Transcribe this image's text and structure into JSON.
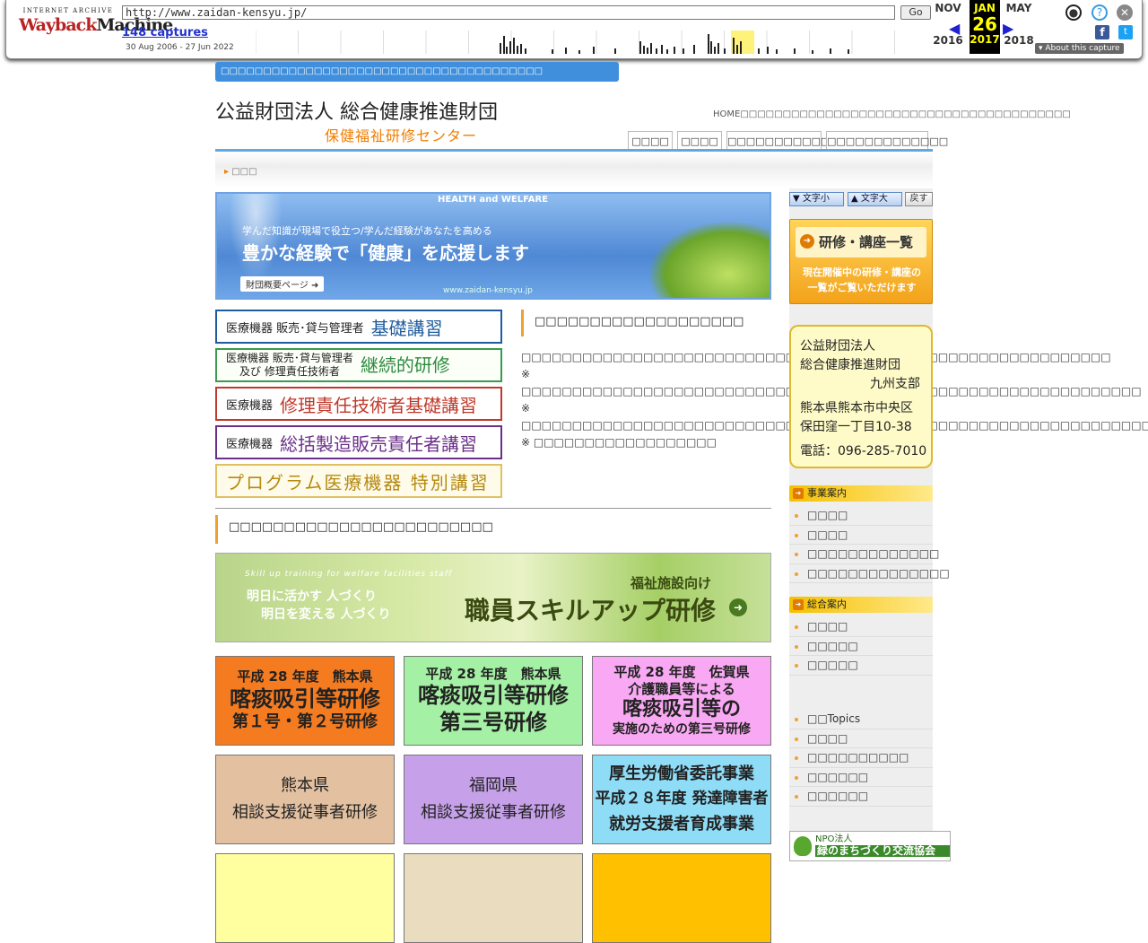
{
  "wayback": {
    "logo_top": "INTERNET ARCHIVE",
    "logo_a": "Wayback",
    "logo_b": "Machine",
    "url": "http://www.zaidan-kensyu.jp/",
    "go": "Go",
    "captures": "148 captures",
    "range": "30 Aug 2006 - 27 Jun 2022",
    "prev_month": "NOV",
    "prev_year": "2016",
    "cur_month": "JAN",
    "cur_day": "26",
    "cur_year": "2017",
    "next_month": "MAY",
    "next_year": "2018",
    "about": "▾ About this capture"
  },
  "header": {
    "topbar": "□□□□□□□□□□□□□□□□□□□□□□□□□□□□□□□□□□□□□□",
    "org_name": "公益財団法人 総合健康推進財団",
    "org_sub": "保健福祉研修センター",
    "top_links": "HOME□□□□□□□□□□□□□□□□□□□□□□□□□□□□□□□□□□□□□□□",
    "nav": [
      "□□□□",
      "□□□□",
      "□□□□□□□□□□□□",
      "□□□□□□□□□□□□□"
    ]
  },
  "breadcrumb": "□□□",
  "hero": {
    "tag": "HEALTH and WELFARE",
    "line1": "学んだ知識が現場で役立つ/学んだ経験があなたを高める",
    "line2": "豊かな経験で「健康」を応援します",
    "button": "財団概要ページ ➜",
    "url": "www.zaidan-kensyu.jp"
  },
  "courses": [
    {
      "small": "医療機器 販売･貸与管理者",
      "big": "基礎講習"
    },
    {
      "small": "医療機器 販売･貸与管理者\n及び 修理責任技術者",
      "big": "継続的研修"
    },
    {
      "small": "医療機器",
      "big": "修理責任技術者基礎講習"
    },
    {
      "small": "医療機器",
      "big": "総括製造販売責任者講習"
    },
    {
      "small": "",
      "big": "プログラム医療機器 特別講習"
    }
  ],
  "notice": {
    "heading": "□□□□□□□□□□□□□□□□□□□",
    "p1": "□□□□□□□□□□□□□□□□□□□□□□□□□□□□□□□□□□□□□□□□□□□□□□□□□□□□□□□□□□",
    "p2": "※ □□□□□□□□□□□□□□□□□□□□□□□□□□□□□□□□□□□□□□□□□□□□□□□□□□□□□□□□□□□□□",
    "p3": "※ □□□□□□□□□□□□□□□□□□□□□□□□□□□□□□□□□□□□□□□□□□□□□□□□□□□□□□□□□□□□□□□□□",
    "p4": "※ □□□□□□□□□□□□□□□□□□"
  },
  "section2_heading": "□□□□□□□□□□□□□□□□□□□□□□□□",
  "skill": {
    "en": "Skill up training for welfare facilities staff",
    "a1": "明日に活かす 人づくり",
    "a2": "明日を変える 人づくり",
    "b": "福祉施設向け",
    "c": "職員スキルアップ研修",
    "go": "➜"
  },
  "boxes": [
    {
      "l1": "平成 28 年度　熊本県",
      "l2": "喀痰吸引等研修",
      "l3": "第１号・第２号研修"
    },
    {
      "l1": "平成 28 年度　熊本県",
      "l2": "喀痰吸引等研修",
      "l3": "第三号研修"
    },
    {
      "l1": "平成 28 年度　佐賀県",
      "l2": "介護職員等による",
      "l3": "喀痰吸引等の",
      "l4": "実施のための第三号研修"
    },
    {
      "l1": "熊本県",
      "l2": "相談支援従事者研修"
    },
    {
      "l1": "福岡県",
      "l2": "相談支援従事者研修"
    },
    {
      "l1": "厚生労働省委託事業",
      "l2": "平成２８年度 発達障害者",
      "l3": "就労支援者育成事業"
    }
  ],
  "sidebar": {
    "font_small": "▼ 文字小",
    "font_large": "▲ 文字大",
    "back": "戻す",
    "kenshu_title": "研修・講座一覧",
    "kenshu_desc1": "現在開催中の研修・講座の",
    "kenshu_desc2": "一覧がご覧いただけます",
    "addr": [
      "公益財団法人",
      "総合健康推進財団",
      "九州支部",
      "熊本県熊本市中央区",
      "保田窪一丁目10-38",
      "電話：096-285-7010"
    ],
    "menu1_title": "事業案内",
    "menu1": [
      "□□□□",
      "□□□□",
      "□□□□□□□□□□□□□",
      "□□□□□□□□□□□□□□"
    ],
    "menu2_title": "総合案内",
    "menu2": [
      "□□□□",
      "□□□□□",
      "□□□□□"
    ],
    "menu3": [
      "□□Topics",
      "□□□□",
      "□□□□□□□□□□",
      "□□□□□□",
      "□□□□□□"
    ],
    "npo_a": "NPO法人",
    "npo_b": "緑のまちづくり交流協会"
  }
}
